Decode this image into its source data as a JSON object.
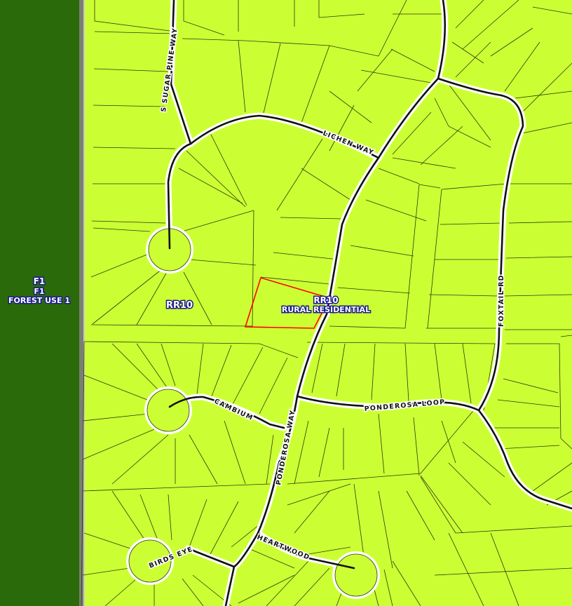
{
  "map": {
    "background_color": "#ccff33",
    "forest_color": "#2b6a0a",
    "selected_parcel_color": "#ff0000"
  },
  "zones": {
    "forest": {
      "code": "F1",
      "code2": "F1",
      "name": "FOREST USE 1"
    },
    "rr_west": {
      "code": "RR10"
    },
    "rr_center": {
      "code": "RR10",
      "name": "RURAL RESIDENTIAL"
    }
  },
  "roads": {
    "sugar_pine": "S SUGAR PINE WAY",
    "lichen": "LICHEN WAY",
    "foxtail": "FOXTAIL RD",
    "ponderosa_loop": "PONDEROSA LOOP",
    "cambium": "CAMBIUM",
    "ponderosa_way": "PONDEROSA WAY",
    "heartwood": "HEARTWOOD",
    "birds_eye": "BIRDS EYE"
  }
}
